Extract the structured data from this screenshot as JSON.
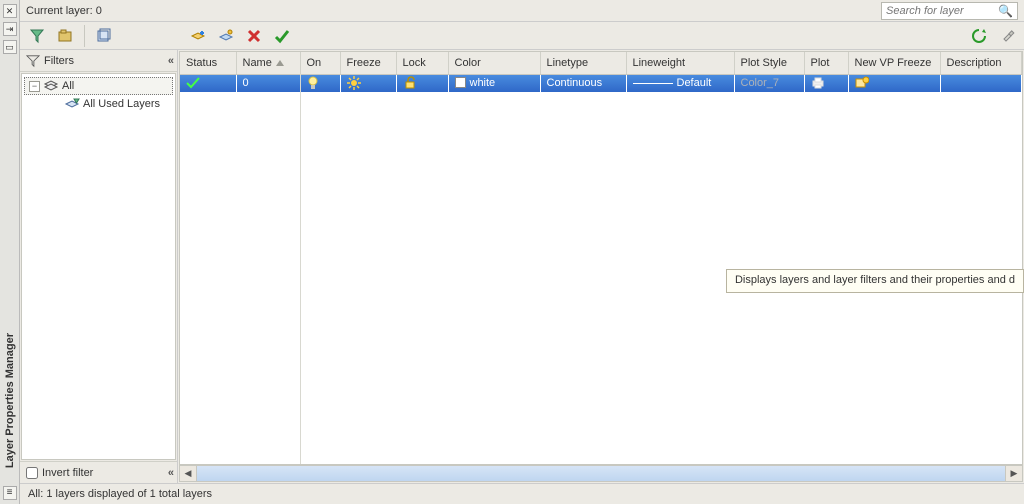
{
  "window": {
    "title": "Layer Properties Manager"
  },
  "header": {
    "current": "Current layer: 0"
  },
  "search": {
    "placeholder": "Search for layer"
  },
  "filters": {
    "label": "Filters",
    "tree": {
      "root": "All",
      "child1": "All Used Layers"
    },
    "invert": "Invert filter"
  },
  "columns": {
    "status": "Status",
    "name": "Name",
    "on": "On",
    "freeze": "Freeze",
    "lock": "Lock",
    "color": "Color",
    "linetype": "Linetype",
    "lineweight": "Lineweight",
    "plotstyle": "Plot Style",
    "plot": "Plot",
    "newvp": "New VP Freeze",
    "description": "Description"
  },
  "rows": [
    {
      "name": "0",
      "color": "white",
      "linetype": "Continuous",
      "lineweight": "Default",
      "plotstyle": "Color_7"
    }
  ],
  "status_bar": "All: 1 layers displayed of 1 total layers",
  "tooltip": "Displays layers and layer filters and their properties and d"
}
